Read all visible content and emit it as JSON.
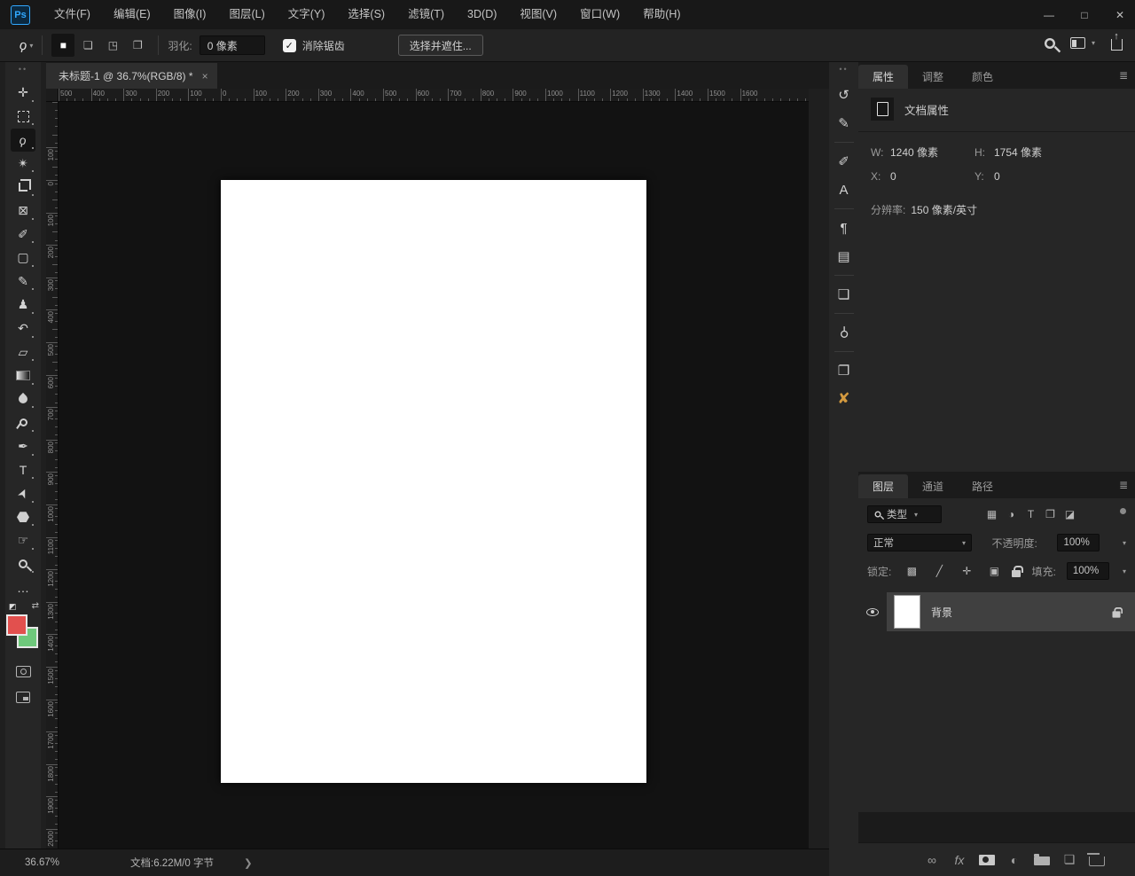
{
  "window_controls": {
    "minimize": "—",
    "maximize": "□",
    "close": "✕"
  },
  "menu_bar": {
    "logo": "Ps",
    "items": [
      "文件(F)",
      "编辑(E)",
      "图像(I)",
      "图层(L)",
      "文字(Y)",
      "选择(S)",
      "滤镜(T)",
      "3D(D)",
      "视图(V)",
      "窗口(W)",
      "帮助(H)"
    ]
  },
  "options_bar": {
    "tool_glyph": "ϙ",
    "dropdown_caret": "▾",
    "modes": [
      {
        "name": "new-selection-button",
        "glyph": "■",
        "active": true
      },
      {
        "name": "add-to-selection-button",
        "glyph": "❏",
        "active": false
      },
      {
        "name": "subtract-from-selection-button",
        "glyph": "◳",
        "active": false
      },
      {
        "name": "intersect-selection-button",
        "glyph": "❐",
        "active": false
      }
    ],
    "feather_label": "羽化:",
    "feather_value": "0 像素",
    "anti_alias_checked": "✓",
    "anti_alias_label": "消除锯齿",
    "select_and_mask_label": "选择并遮住..."
  },
  "document_tab": {
    "title": "未标题-1 @ 36.7%(RGB/8) *",
    "close": "×"
  },
  "rulers": {
    "h_labels": [
      "500",
      "400",
      "300",
      "200",
      "100",
      "0",
      "100",
      "200",
      "300",
      "400",
      "500",
      "600",
      "700",
      "800",
      "900",
      "1000",
      "1100",
      "1200",
      "1300",
      "1400",
      "1500",
      "1600"
    ],
    "v_labels": [
      "100",
      "0",
      "100",
      "200",
      "300",
      "400",
      "500",
      "600",
      "700",
      "800",
      "900",
      "1000",
      "1100",
      "1200",
      "1300",
      "1400",
      "1500",
      "1600",
      "1700",
      "1800",
      "1900",
      "2000"
    ]
  },
  "toolbar": {
    "tools": [
      {
        "name": "move-tool",
        "glyph": "✛"
      },
      {
        "name": "marquee-tool",
        "css": "marq"
      },
      {
        "name": "lasso-tool",
        "glyph": "ϙ",
        "selected": true
      },
      {
        "name": "quick-select-tool",
        "glyph": "✴"
      },
      {
        "name": "crop-tool",
        "css": "crop"
      },
      {
        "name": "frame-tool",
        "glyph": "⊠"
      },
      {
        "name": "eyedropper-tool",
        "glyph": "✐"
      },
      {
        "name": "healing-brush-tool",
        "glyph": "▢"
      },
      {
        "name": "brush-tool",
        "glyph": "✎"
      },
      {
        "name": "clone-stamp-tool",
        "glyph": "♟"
      },
      {
        "name": "history-brush-tool",
        "glyph": "↶"
      },
      {
        "name": "eraser-tool",
        "glyph": "▱"
      },
      {
        "name": "gradient-tool",
        "css": "grad"
      },
      {
        "name": "blur-tool",
        "css": "drop"
      },
      {
        "name": "dodge-tool",
        "css": "lolli"
      },
      {
        "name": "pen-tool",
        "glyph": "✒"
      },
      {
        "name": "type-tool",
        "glyph": "T"
      },
      {
        "name": "path-select-tool",
        "glyph": "➤"
      },
      {
        "name": "shape-tool",
        "css": "hex"
      },
      {
        "name": "hand-tool",
        "glyph": "☞"
      },
      {
        "name": "zoom-tool",
        "css": "mag"
      },
      {
        "name": "edit-toolbar-button",
        "glyph": "…"
      }
    ]
  },
  "dock_panels": [
    {
      "name": "history-panel-icon",
      "glyph": "↺"
    },
    {
      "name": "brush-settings-panel-icon",
      "glyph": "✎"
    },
    {
      "name": "brushes-panel-icon",
      "glyph": "✐",
      "divider": true
    },
    {
      "name": "character-panel-icon",
      "glyph": "A"
    },
    {
      "name": "paragraph-panel-icon",
      "glyph": "¶",
      "divider": true
    },
    {
      "name": "libraries-panel-icon",
      "glyph": "▤"
    },
    {
      "name": "adjustments-panel-icon",
      "glyph": "❏",
      "divider": true
    },
    {
      "name": "learn-panel-icon",
      "glyph": "⚲",
      "divider": true
    },
    {
      "name": "clipboard-panel-icon",
      "glyph": "❐",
      "divider": true
    },
    {
      "name": "plugin-panel-icon",
      "glyph": "✘",
      "gold": true
    }
  ],
  "properties_panel": {
    "tabs": [
      {
        "label": "属性",
        "active": true
      },
      {
        "label": "调整",
        "active": false
      },
      {
        "label": "颜色",
        "active": false
      }
    ],
    "section_title": "文档属性",
    "w_label": "W:",
    "w_value": "1240 像素",
    "h_label": "H:",
    "h_value": "1754 像素",
    "x_label": "X:",
    "x_value": "0",
    "y_label": "Y:",
    "y_value": "0",
    "resolution_label": "分辨率:",
    "resolution_value": "150 像素/英寸"
  },
  "layers_panel": {
    "tabs": [
      {
        "label": "图层",
        "active": true
      },
      {
        "label": "通道",
        "active": false
      },
      {
        "label": "路径",
        "active": false
      }
    ],
    "kind_label": "类型",
    "filter_icons": [
      {
        "name": "filter-pixel-layers-icon",
        "glyph": "▦"
      },
      {
        "name": "filter-adjustment-layers-icon",
        "glyph": "◑"
      },
      {
        "name": "filter-type-layers-icon",
        "glyph": "T"
      },
      {
        "name": "filter-group-layers-icon",
        "glyph": "❐"
      },
      {
        "name": "filter-smart-objects-icon",
        "glyph": "◪"
      }
    ],
    "blend_mode": "正常",
    "opacity_label": "不透明度:",
    "opacity_value": "100%",
    "lock_label": "锁定:",
    "lock_icons": [
      {
        "name": "lock-transparent-pixels-icon",
        "glyph": "▩"
      },
      {
        "name": "lock-image-pixels-icon",
        "glyph": "╱"
      },
      {
        "name": "lock-position-icon",
        "glyph": "✛"
      },
      {
        "name": "lock-artboard-icon",
        "glyph": "▣"
      },
      {
        "name": "lock-all-icon",
        "css": "lock"
      }
    ],
    "fill_label": "填充:",
    "fill_value": "100%",
    "layers": [
      {
        "name": "背景",
        "visible": true,
        "locked": true
      }
    ],
    "bottom_icons": [
      {
        "name": "link-layers-icon",
        "glyph": "∞"
      },
      {
        "name": "layer-styles-icon",
        "glyph": "fx"
      },
      {
        "name": "add-layer-mask-icon",
        "css": "mask"
      },
      {
        "name": "new-adjustment-layer-icon",
        "glyph": "◐"
      },
      {
        "name": "new-group-icon",
        "css": "folder"
      },
      {
        "name": "new-layer-icon",
        "glyph": "❏"
      },
      {
        "name": "delete-layer-icon",
        "css": "trash"
      }
    ]
  },
  "status_bar": {
    "zoom_level": "36.67%",
    "doc_info": "文档:6.22M/0 字节",
    "chevron": "❯"
  },
  "colors": {
    "foreground": "#e2504e",
    "background": "#6ec87b",
    "accent_blue": "#31a8ff",
    "plugin_gold": "#d49a3f"
  }
}
